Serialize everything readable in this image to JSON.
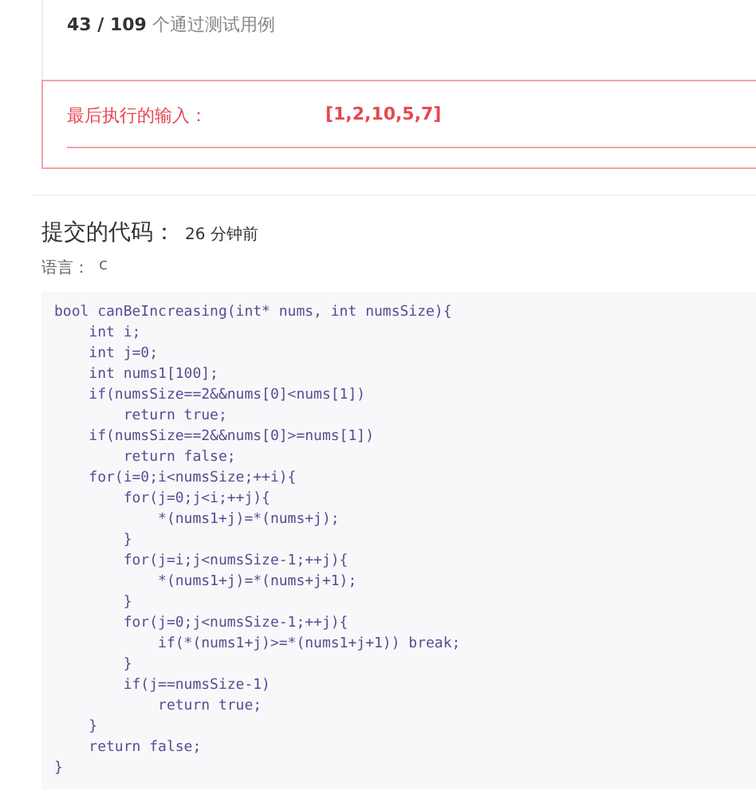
{
  "result": {
    "passed": "43 / 109",
    "passed_label": "个通过测试用例"
  },
  "last_input": {
    "label": "最后执行的输入：",
    "value": "[1,2,10,5,7]"
  },
  "submission": {
    "title": "提交的代码：",
    "time": "26 分钟前",
    "language_label": "语言：",
    "language": "c"
  },
  "code_lines": [
    "bool canBeIncreasing(int* nums, int numsSize){",
    "    int i;",
    "    int j=0;",
    "    int nums1[100];",
    "    if(numsSize==2&&nums[0]<nums[1])",
    "        return true;",
    "    if(numsSize==2&&nums[0]>=nums[1])",
    "        return false;",
    "    for(i=0;i<numsSize;++i){",
    "        for(j=0;j<i;++j){",
    "            *(nums1+j)=*(nums+j);",
    "        }",
    "        for(j=i;j<numsSize-1;++j){",
    "            *(nums1+j)=*(nums+j+1);",
    "        }",
    "        for(j=0;j<numsSize-1;++j){",
    "            if(*(nums1+j)>=*(nums1+j+1)) break;",
    "        }",
    "        if(j==numsSize-1)",
    "            return true;",
    "    }",
    "    return false;",
    "}"
  ]
}
